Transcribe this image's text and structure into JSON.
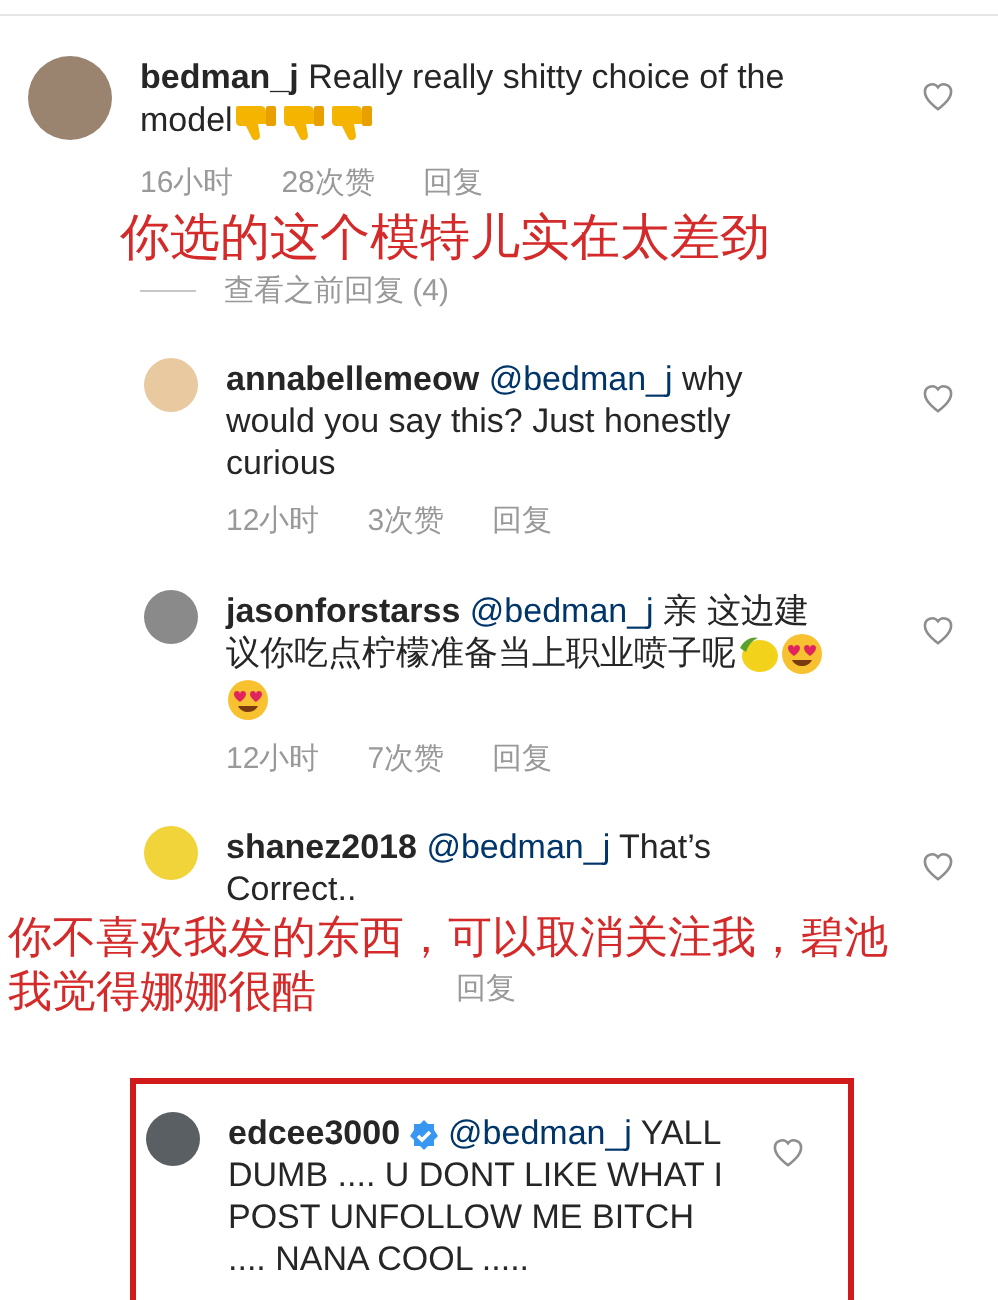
{
  "comment": {
    "username": "bedman_j",
    "color": "#9a8470",
    "text": "Really really shitty choice of the model",
    "emojis": [
      {
        "kind": "thumbs-down"
      },
      {
        "kind": "thumbs-down"
      },
      {
        "kind": "thumbs-down"
      }
    ],
    "time": "16小时",
    "likes": "28次赞",
    "reply": "回复",
    "liked": false,
    "annotation": [
      "你选的这个模特儿实在太差劲"
    ],
    "view_previous": "查看之前回复 (4)",
    "replies": [
      {
        "username": "annabellemeow",
        "color": "#e8c9a0",
        "mention": "@bedman_j",
        "text": "why would you say this? Just honestly curious",
        "time": "12小时",
        "likes": "3次赞",
        "reply": "回复",
        "liked": false
      },
      {
        "username": "jasonforstarss",
        "color": "#8a8a8a",
        "mention": "@bedman_j",
        "text": "亲 这边建议你吃点柠檬准备当上职业喷子呢",
        "emojis": [
          {
            "kind": "lemon"
          },
          {
            "kind": "heart-eyes"
          },
          {
            "kind": "heart-eyes"
          }
        ],
        "time": "12小时",
        "likes": "7次赞",
        "reply": "回复",
        "liked": false
      },
      {
        "username": "shanez2018",
        "color": "#f0d43a",
        "mention": "@bedman_j",
        "text": "That’s Correct..",
        "reply": "回复",
        "liked": false,
        "annotation": [
          "你不喜欢我发的东西，可以取消关注我，碧池",
          "我觉得娜娜很酷"
        ]
      },
      {
        "username": "edcee3000",
        "color": "#5a5f63",
        "verified": true,
        "highlighted": true,
        "mention": "@bedman_j",
        "text": "YALL DUMB .... U DONT LIKE WHAT I POST UNFOLLOW ME BITCH .... NANA COOL .....",
        "liked": false
      }
    ]
  }
}
